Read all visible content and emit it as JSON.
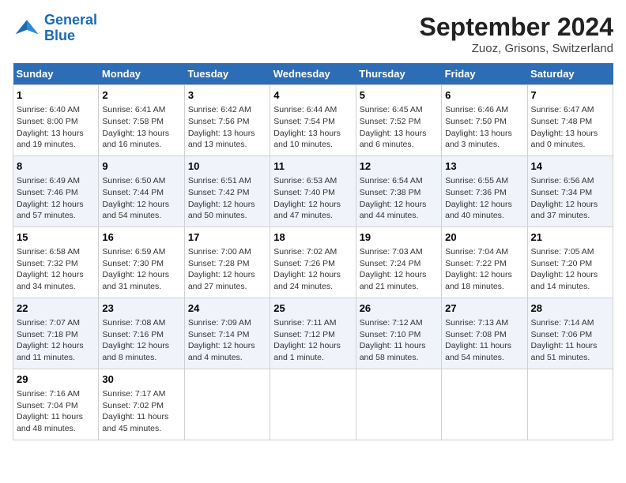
{
  "logo": {
    "line1": "General",
    "line2": "Blue"
  },
  "title": "September 2024",
  "location": "Zuoz, Grisons, Switzerland",
  "weekdays": [
    "Sunday",
    "Monday",
    "Tuesday",
    "Wednesday",
    "Thursday",
    "Friday",
    "Saturday"
  ],
  "weeks": [
    [
      {
        "day": "1",
        "detail": "Sunrise: 6:40 AM\nSunset: 8:00 PM\nDaylight: 13 hours\nand 19 minutes."
      },
      {
        "day": "2",
        "detail": "Sunrise: 6:41 AM\nSunset: 7:58 PM\nDaylight: 13 hours\nand 16 minutes."
      },
      {
        "day": "3",
        "detail": "Sunrise: 6:42 AM\nSunset: 7:56 PM\nDaylight: 13 hours\nand 13 minutes."
      },
      {
        "day": "4",
        "detail": "Sunrise: 6:44 AM\nSunset: 7:54 PM\nDaylight: 13 hours\nand 10 minutes."
      },
      {
        "day": "5",
        "detail": "Sunrise: 6:45 AM\nSunset: 7:52 PM\nDaylight: 13 hours\nand 6 minutes."
      },
      {
        "day": "6",
        "detail": "Sunrise: 6:46 AM\nSunset: 7:50 PM\nDaylight: 13 hours\nand 3 minutes."
      },
      {
        "day": "7",
        "detail": "Sunrise: 6:47 AM\nSunset: 7:48 PM\nDaylight: 13 hours\nand 0 minutes."
      }
    ],
    [
      {
        "day": "8",
        "detail": "Sunrise: 6:49 AM\nSunset: 7:46 PM\nDaylight: 12 hours\nand 57 minutes."
      },
      {
        "day": "9",
        "detail": "Sunrise: 6:50 AM\nSunset: 7:44 PM\nDaylight: 12 hours\nand 54 minutes."
      },
      {
        "day": "10",
        "detail": "Sunrise: 6:51 AM\nSunset: 7:42 PM\nDaylight: 12 hours\nand 50 minutes."
      },
      {
        "day": "11",
        "detail": "Sunrise: 6:53 AM\nSunset: 7:40 PM\nDaylight: 12 hours\nand 47 minutes."
      },
      {
        "day": "12",
        "detail": "Sunrise: 6:54 AM\nSunset: 7:38 PM\nDaylight: 12 hours\nand 44 minutes."
      },
      {
        "day": "13",
        "detail": "Sunrise: 6:55 AM\nSunset: 7:36 PM\nDaylight: 12 hours\nand 40 minutes."
      },
      {
        "day": "14",
        "detail": "Sunrise: 6:56 AM\nSunset: 7:34 PM\nDaylight: 12 hours\nand 37 minutes."
      }
    ],
    [
      {
        "day": "15",
        "detail": "Sunrise: 6:58 AM\nSunset: 7:32 PM\nDaylight: 12 hours\nand 34 minutes."
      },
      {
        "day": "16",
        "detail": "Sunrise: 6:59 AM\nSunset: 7:30 PM\nDaylight: 12 hours\nand 31 minutes."
      },
      {
        "day": "17",
        "detail": "Sunrise: 7:00 AM\nSunset: 7:28 PM\nDaylight: 12 hours\nand 27 minutes."
      },
      {
        "day": "18",
        "detail": "Sunrise: 7:02 AM\nSunset: 7:26 PM\nDaylight: 12 hours\nand 24 minutes."
      },
      {
        "day": "19",
        "detail": "Sunrise: 7:03 AM\nSunset: 7:24 PM\nDaylight: 12 hours\nand 21 minutes."
      },
      {
        "day": "20",
        "detail": "Sunrise: 7:04 AM\nSunset: 7:22 PM\nDaylight: 12 hours\nand 18 minutes."
      },
      {
        "day": "21",
        "detail": "Sunrise: 7:05 AM\nSunset: 7:20 PM\nDaylight: 12 hours\nand 14 minutes."
      }
    ],
    [
      {
        "day": "22",
        "detail": "Sunrise: 7:07 AM\nSunset: 7:18 PM\nDaylight: 12 hours\nand 11 minutes."
      },
      {
        "day": "23",
        "detail": "Sunrise: 7:08 AM\nSunset: 7:16 PM\nDaylight: 12 hours\nand 8 minutes."
      },
      {
        "day": "24",
        "detail": "Sunrise: 7:09 AM\nSunset: 7:14 PM\nDaylight: 12 hours\nand 4 minutes."
      },
      {
        "day": "25",
        "detail": "Sunrise: 7:11 AM\nSunset: 7:12 PM\nDaylight: 12 hours\nand 1 minute."
      },
      {
        "day": "26",
        "detail": "Sunrise: 7:12 AM\nSunset: 7:10 PM\nDaylight: 11 hours\nand 58 minutes."
      },
      {
        "day": "27",
        "detail": "Sunrise: 7:13 AM\nSunset: 7:08 PM\nDaylight: 11 hours\nand 54 minutes."
      },
      {
        "day": "28",
        "detail": "Sunrise: 7:14 AM\nSunset: 7:06 PM\nDaylight: 11 hours\nand 51 minutes."
      }
    ],
    [
      {
        "day": "29",
        "detail": "Sunrise: 7:16 AM\nSunset: 7:04 PM\nDaylight: 11 hours\nand 48 minutes."
      },
      {
        "day": "30",
        "detail": "Sunrise: 7:17 AM\nSunset: 7:02 PM\nDaylight: 11 hours\nand 45 minutes."
      },
      {
        "day": "",
        "detail": ""
      },
      {
        "day": "",
        "detail": ""
      },
      {
        "day": "",
        "detail": ""
      },
      {
        "day": "",
        "detail": ""
      },
      {
        "day": "",
        "detail": ""
      }
    ]
  ]
}
